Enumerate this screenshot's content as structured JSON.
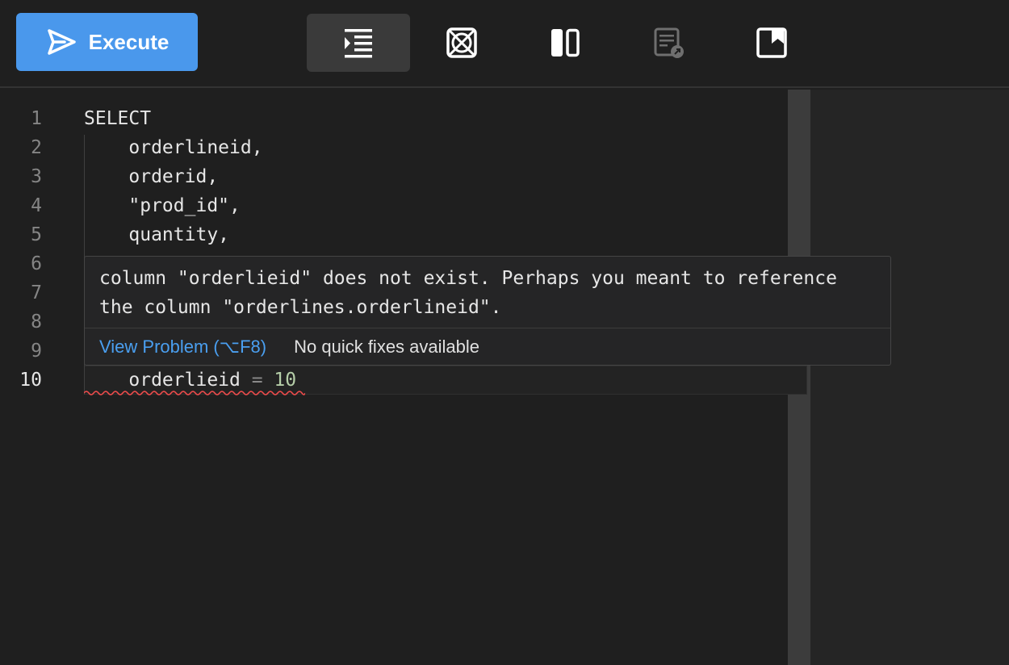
{
  "toolbar": {
    "execute_label": "Execute",
    "icons": [
      "format-icon",
      "clear-icon",
      "split-view-icon",
      "explain-icon",
      "bookmark-icon"
    ]
  },
  "editor": {
    "lines": [
      {
        "num": "1",
        "code": "SELECT"
      },
      {
        "num": "2",
        "code": "    orderlineid,"
      },
      {
        "num": "3",
        "code": "    orderid,"
      },
      {
        "num": "4",
        "code": "    \"prod_id\","
      },
      {
        "num": "5",
        "code": "    quantity,"
      },
      {
        "num": "6",
        "code": ""
      },
      {
        "num": "7",
        "code": ""
      },
      {
        "num": "8",
        "code": ""
      },
      {
        "num": "9",
        "code": ""
      },
      {
        "num": "10",
        "code_ident": "    orderlieid ",
        "code_op": "=",
        "code_num": " 10"
      }
    ],
    "current_line": "10"
  },
  "hover": {
    "message_line1": "column \"orderlieid\" does not exist. Perhaps you meant to reference",
    "message_line2": "the column \"orderlines.orderlineid\".",
    "view_problem": "View Problem (⌥F8)",
    "no_fixes": "No quick fixes available"
  },
  "colors": {
    "accent": "#4a98ec",
    "keyword": "#569cd6",
    "number": "#b5cea8",
    "error": "#f14c4c",
    "link": "#4a9ff0"
  }
}
